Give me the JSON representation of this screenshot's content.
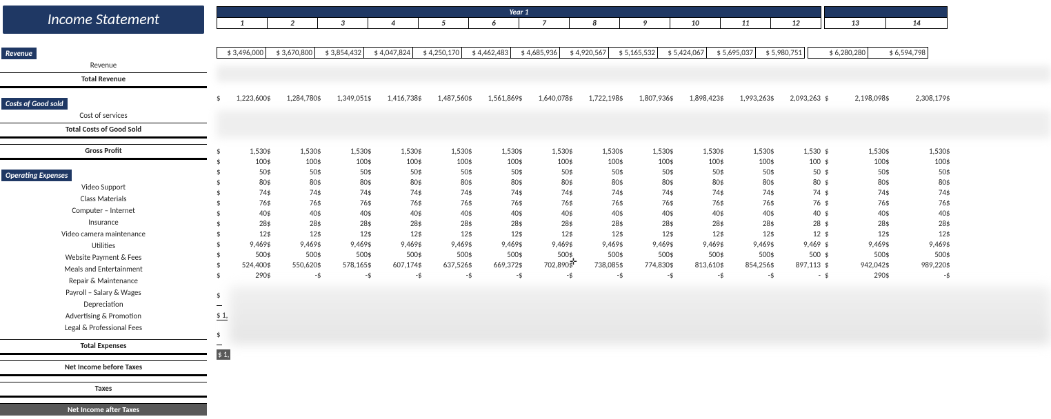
{
  "title": "Income Statement",
  "year_label": "Year 1",
  "periods_a": [
    "1",
    "2",
    "3",
    "4",
    "5",
    "6",
    "7",
    "8",
    "9",
    "10",
    "11",
    "12"
  ],
  "periods_b": [
    "13",
    "14"
  ],
  "sections": {
    "revenue_hdr": "Revenue",
    "revenue_row": "Revenue",
    "total_revenue": "Total Revenue",
    "cogs_hdr": "Costs of Good sold",
    "cogs_row": "Cost of services",
    "total_cogs": "Total Costs of Good Sold",
    "gross_profit": "Gross Profit",
    "opex_hdr": "Operating Expenses",
    "total_expenses": "Total Expenses",
    "nibt": "Net Income before Taxes",
    "taxes": "Taxes",
    "niat": "Net Income after Taxes"
  },
  "opex_labels": [
    "Video Support",
    "Class Materials",
    "Computer – Internet",
    "Insurance",
    "Video camera maintenance",
    "Utilities",
    "Website Payment & Fees",
    "Meals and Entertainment",
    "Repair & Maintenance",
    "Payroll – Salary & Wages",
    "Depreciation",
    "Advertising & Promotion",
    "Legal & Professional Fees"
  ],
  "revenue_a": [
    "$ 3,496,000",
    "$   3,670,800",
    "$   3,854,432",
    "$   4,047,824",
    "$    4,250,170",
    "$    4,462,483",
    "$    4,685,936",
    "$    4,920,567",
    "$    5,165,532",
    "$    5,424,067",
    "$    5,695,037",
    "$    5,980,751"
  ],
  "revenue_b": [
    "6,280,280",
    "6,594,798"
  ],
  "cogs_a": [
    "1,223,600",
    "1,284,780",
    "1,349,051",
    "1,416,738",
    "1,487,560",
    "1,561,869",
    "1,640,078",
    "1,722,198",
    "1,807,936",
    "1,898,423",
    "1,993,263",
    "2,093,263"
  ],
  "cogs_b": [
    "2,198,098",
    "2,308,179"
  ],
  "opex_a": [
    [
      "1,530",
      "1,530",
      "1,530",
      "1,530",
      "1,530",
      "1,530",
      "1,530",
      "1,530",
      "1,530",
      "1,530",
      "1,530",
      "1,530"
    ],
    [
      "100",
      "100",
      "100",
      "100",
      "100",
      "100",
      "100",
      "100",
      "100",
      "100",
      "100",
      "100"
    ],
    [
      "50",
      "50",
      "50",
      "50",
      "50",
      "50",
      "50",
      "50",
      "50",
      "50",
      "50",
      "50"
    ],
    [
      "80",
      "80",
      "80",
      "80",
      "80",
      "80",
      "80",
      "80",
      "80",
      "80",
      "80",
      "80"
    ],
    [
      "74",
      "74",
      "74",
      "74",
      "74",
      "74",
      "74",
      "74",
      "74",
      "74",
      "74",
      "74"
    ],
    [
      "76",
      "76",
      "76",
      "76",
      "76",
      "76",
      "76",
      "76",
      "76",
      "76",
      "76",
      "76"
    ],
    [
      "40",
      "40",
      "40",
      "40",
      "40",
      "40",
      "40",
      "40",
      "40",
      "40",
      "40",
      "40"
    ],
    [
      "28",
      "28",
      "28",
      "28",
      "28",
      "28",
      "28",
      "28",
      "28",
      "28",
      "28",
      "28"
    ],
    [
      "12",
      "12",
      "12",
      "12",
      "12",
      "12",
      "12",
      "12",
      "12",
      "12",
      "12",
      "12"
    ],
    [
      "9,469",
      "9,469",
      "9,469",
      "9,469",
      "9,469",
      "9,469",
      "9,469",
      "9,469",
      "9,469",
      "9,469",
      "9,469",
      "9,469"
    ],
    [
      "500",
      "500",
      "500",
      "500",
      "500",
      "500",
      "500",
      "500",
      "500",
      "500",
      "500",
      "500"
    ],
    [
      "524,400",
      "550,620",
      "578,165",
      "607,174",
      "637,526",
      "669,372",
      "702,890",
      "738,085",
      "774,830",
      "813,610",
      "854,256",
      "897,113"
    ],
    [
      "290",
      "-",
      "-",
      "-",
      "-",
      "-",
      "-",
      "-",
      "-",
      "-",
      "-",
      "-"
    ]
  ],
  "opex_b": [
    [
      "1,530",
      "1,530"
    ],
    [
      "100",
      "100"
    ],
    [
      "50",
      "50"
    ],
    [
      "80",
      "80"
    ],
    [
      "74",
      "74"
    ],
    [
      "76",
      "76"
    ],
    [
      "40",
      "40"
    ],
    [
      "28",
      "28"
    ],
    [
      "12",
      "12"
    ],
    [
      "9,469",
      "9,469"
    ],
    [
      "500",
      "500"
    ],
    [
      "942,042",
      "989,220"
    ],
    [
      "290",
      "-"
    ]
  ],
  "partial_prefixes": {
    "total_exp": "$",
    "nibt": "$ 1,",
    "taxes": "$",
    "niat": "$ 1,"
  }
}
